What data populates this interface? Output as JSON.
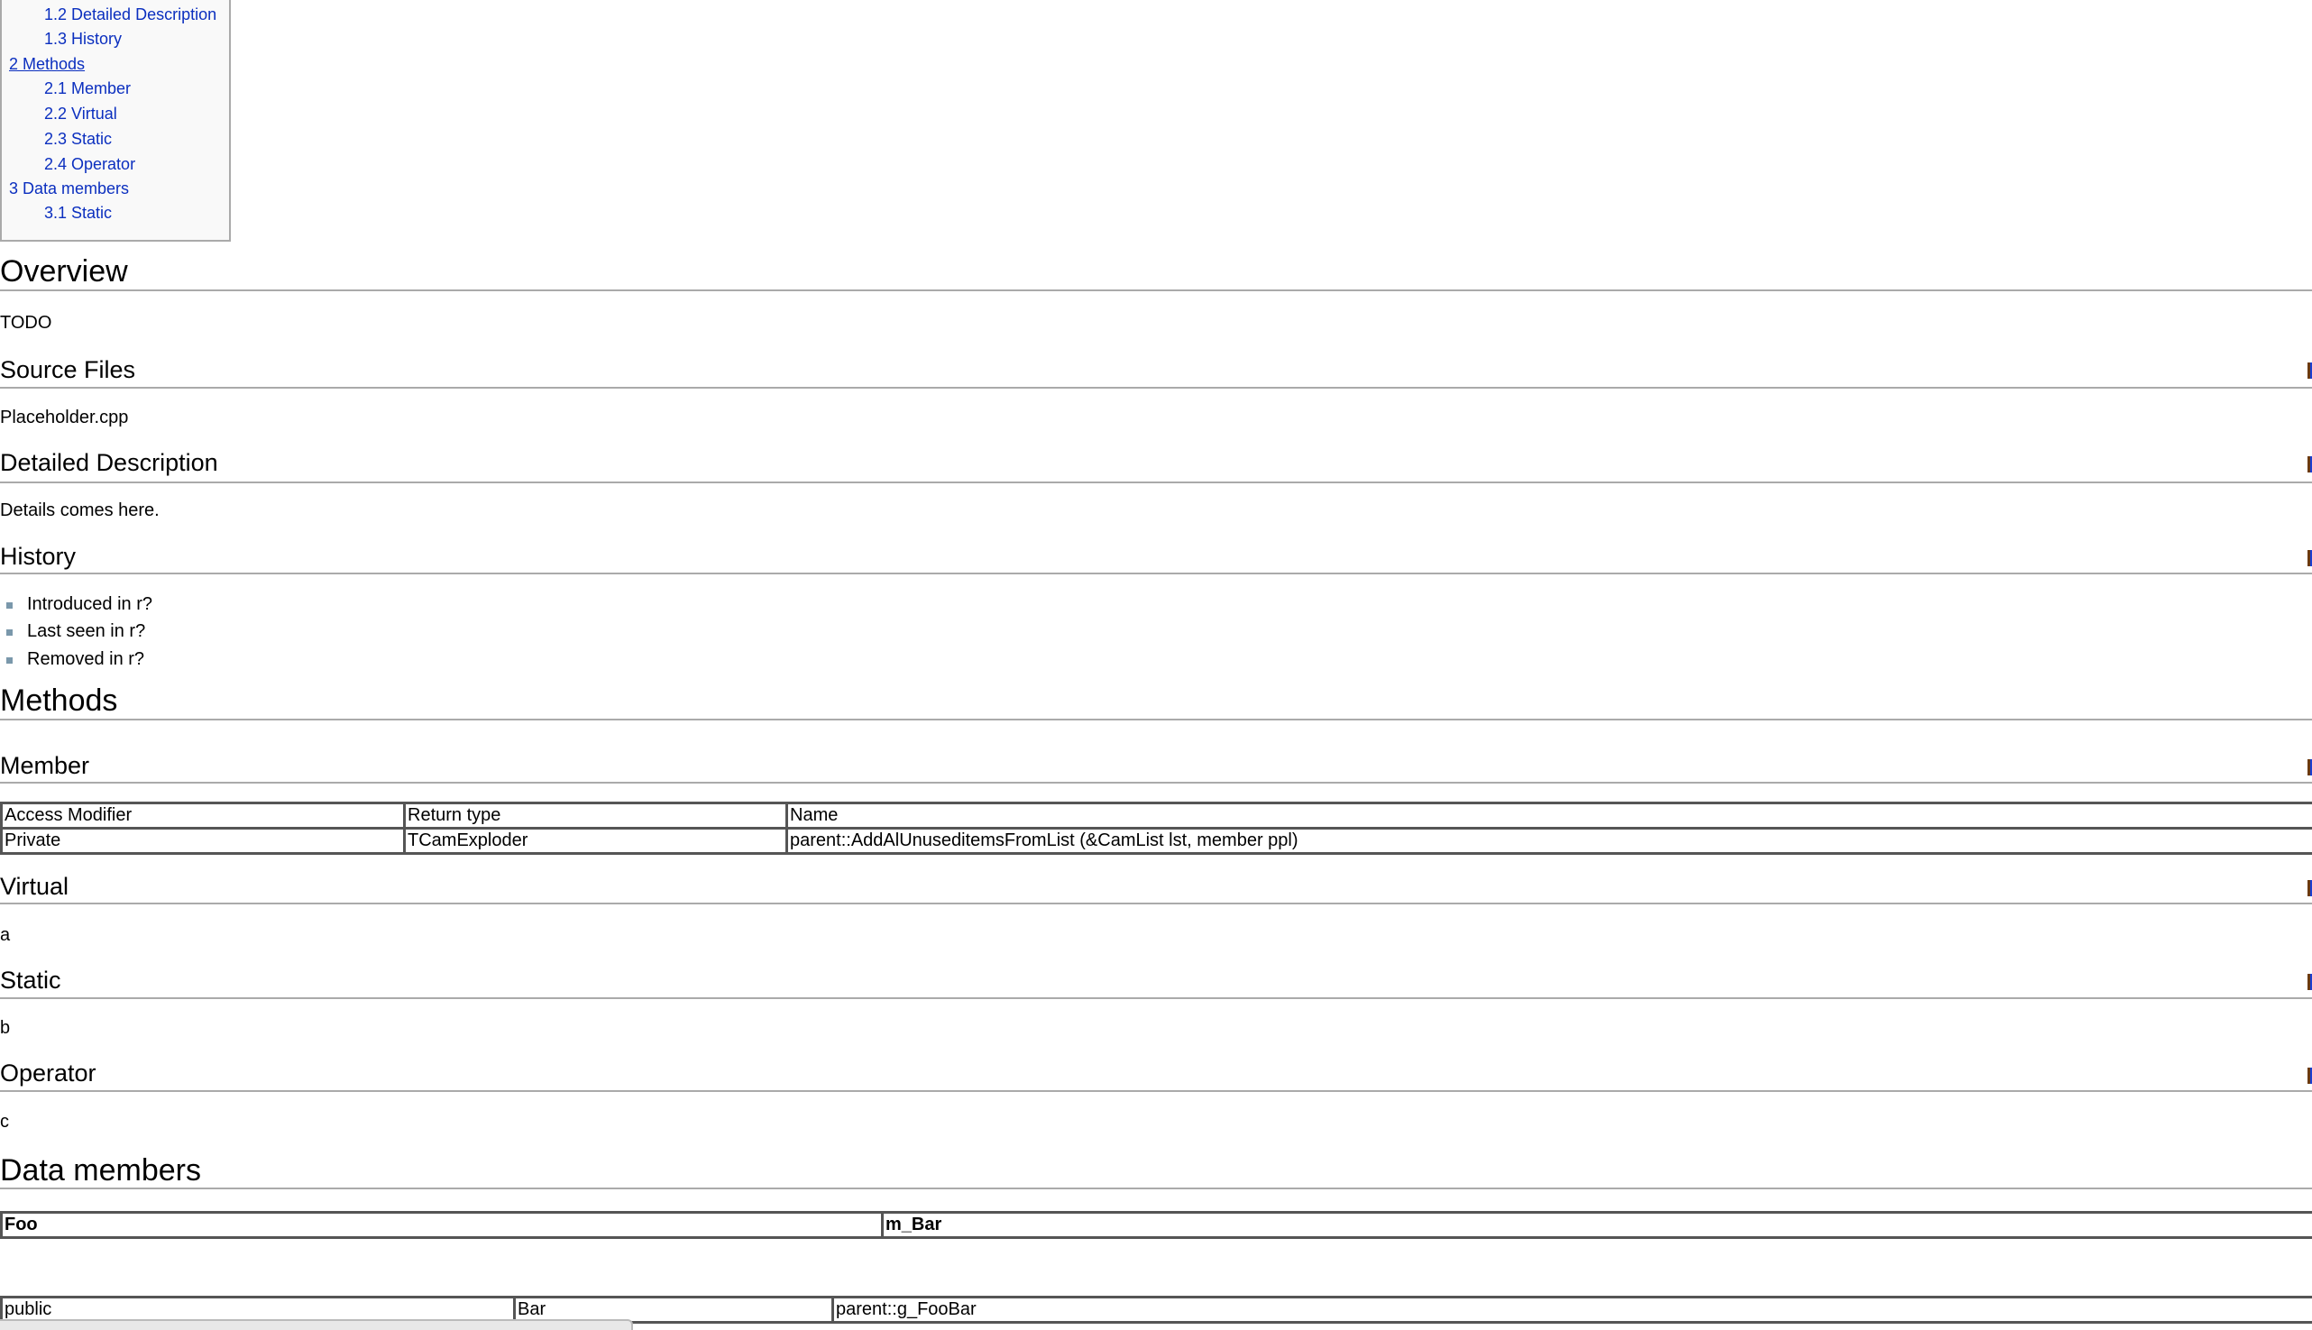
{
  "toc": {
    "items": [
      {
        "label": "1.2 Detailed Description",
        "level": 2
      },
      {
        "label": "1.3 History",
        "level": 2
      },
      {
        "label": "2 Methods",
        "level": 1
      },
      {
        "label": "2.1 Member",
        "level": 2
      },
      {
        "label": "2.2 Virtual",
        "level": 2
      },
      {
        "label": "2.3 Static",
        "level": 2
      },
      {
        "label": "2.4 Operator",
        "level": 2
      },
      {
        "label": "3 Data members",
        "level": 1
      },
      {
        "label": "3.1 Static",
        "level": 2
      }
    ]
  },
  "overview": {
    "heading": "Overview",
    "text": "TODO"
  },
  "source_files": {
    "heading": "Source Files",
    "text": "Placeholder.cpp"
  },
  "detailed": {
    "heading": "Detailed Description",
    "text": "Details comes here."
  },
  "history": {
    "heading": "History",
    "items": [
      "Introduced in r?",
      "Last seen in r?",
      "Removed in r?"
    ]
  },
  "methods": {
    "heading": "Methods",
    "member": {
      "heading": "Member",
      "table": {
        "headers": [
          "Access Modifier",
          "Return type",
          "Name"
        ],
        "rows": [
          [
            "Private",
            "TCamExploder",
            "parent::AddAlUnuseditemsFromList (&CamList lst, member ppl)"
          ]
        ]
      }
    },
    "virtual": {
      "heading": "Virtual",
      "text": "a"
    },
    "static": {
      "heading": "Static",
      "text": "b"
    },
    "operator": {
      "heading": "Operator",
      "text": "c"
    }
  },
  "data_members": {
    "heading": "Data members",
    "table1": [
      "Foo",
      "m_Bar"
    ],
    "table2": [
      "public",
      "Bar",
      "parent::g_FooBar"
    ]
  },
  "colors": {
    "link": "#0b2fbf",
    "rule": "#aaaaaa",
    "toc_bg": "#f9f9f9"
  }
}
